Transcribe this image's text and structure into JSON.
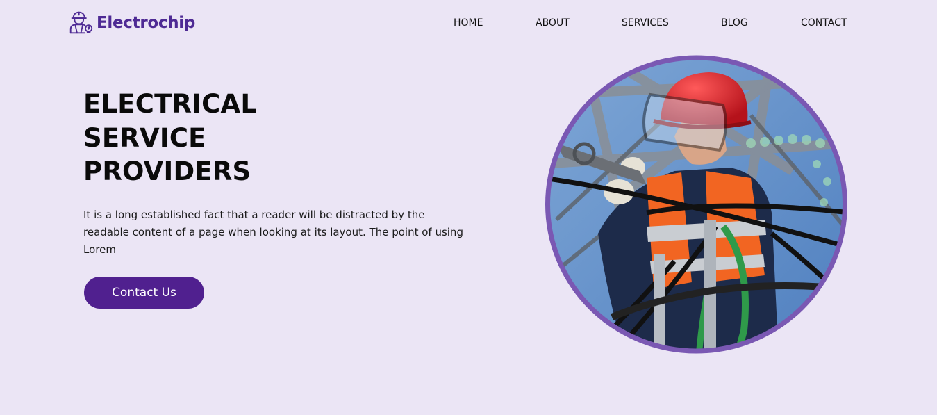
{
  "brand": {
    "name": "Electrochip",
    "logo_icon": "electrician-worker-icon",
    "color": "#4e2a94"
  },
  "nav": {
    "items": [
      {
        "label": "HOME"
      },
      {
        "label": "ABOUT"
      },
      {
        "label": "SERVICES"
      },
      {
        "label": "BLOG"
      },
      {
        "label": "CONTACT"
      }
    ]
  },
  "hero": {
    "title_lines": [
      "ELECTRICAL",
      "SERVICE",
      "PROVIDERS"
    ],
    "description": "It is a long established fact that a reader will be distracted by the readable content of a page when looking at its layout. The point of using Lorem",
    "cta_label": "Contact Us",
    "cta_color": "#50208f",
    "image_icon": "electrician-on-power-tower-photo"
  },
  "colors": {
    "background": "#ebe5f5",
    "accent": "#7a58b3",
    "text": "#0a0a0a"
  }
}
